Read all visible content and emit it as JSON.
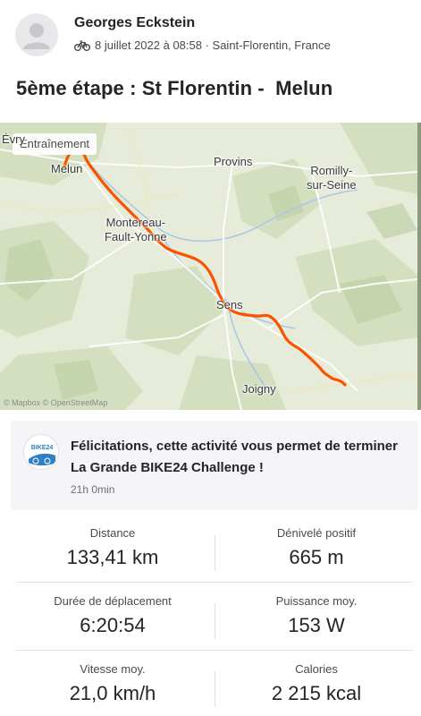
{
  "athlete": {
    "name": "Georges Eckstein"
  },
  "activity": {
    "meta": "8 juillet 2022 à 08:58 · Saint-Florentin, France",
    "title": "5ème étape : St Florentin -  Melun",
    "sport_icon": "bike-icon"
  },
  "map": {
    "badge": "Entraînement",
    "towns": {
      "evry": "Évry",
      "melun": "Melun",
      "provins": "Provins",
      "romilly": "Romilly-\nsur-Seine",
      "montereau": "Montereau-\nFault-Yonne",
      "sens": "Sens",
      "joigny": "Joigny"
    },
    "attribution": "© Mapbox © OpenStreetMap",
    "route_color": "#fc5200"
  },
  "challenge": {
    "text": "Félicitations, cette activité vous permet de terminer La Grande BIKE24 Challenge !",
    "time": "21h 0min",
    "logo_text": "BIKE24"
  },
  "stats": {
    "distance": {
      "label": "Distance",
      "value": "133,41 km"
    },
    "elevation": {
      "label": "Dénivelé positif",
      "value": "665 m"
    },
    "moving_time": {
      "label": "Durée de déplacement",
      "value": "6:20:54"
    },
    "power": {
      "label": "Puissance moy.",
      "value": "153 W"
    },
    "speed": {
      "label": "Vitesse moy.",
      "value": "21,0 km/h"
    },
    "calories": {
      "label": "Calories",
      "value": "2 215 kcal"
    }
  }
}
